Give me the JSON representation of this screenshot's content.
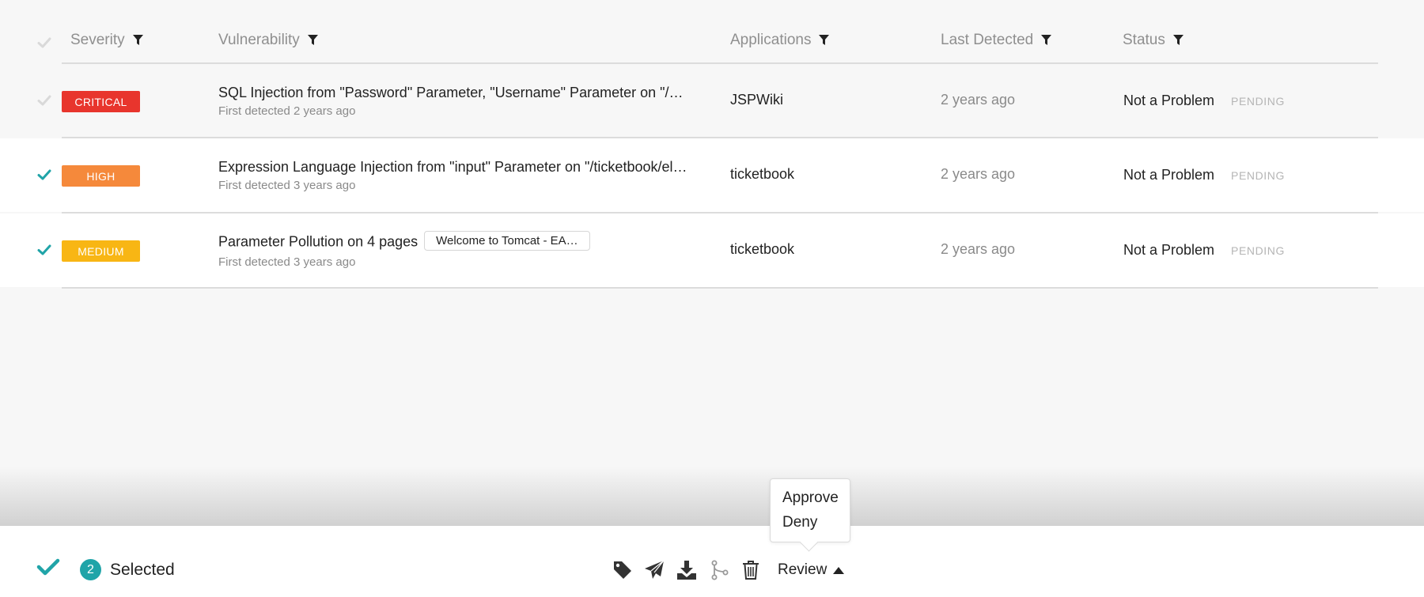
{
  "header": {
    "severity": "Severity",
    "vulnerability": "Vulnerability",
    "applications": "Applications",
    "last_detected": "Last Detected",
    "status": "Status"
  },
  "rows": [
    {
      "checked": false,
      "severity": "CRITICAL",
      "severity_color": "#e8352d",
      "title": "SQL Injection from \"Password\" Parameter, \"Username\" Parameter on \"/…",
      "subtitle": "First detected 2 years ago",
      "tag": "",
      "application": "JSPWiki",
      "last_detected": "2 years ago",
      "status": "Not a Problem",
      "pending": "PENDING"
    },
    {
      "checked": true,
      "severity": "HIGH",
      "severity_color": "#f5893b",
      "title": "Expression Language Injection from \"input\" Parameter on \"/ticketbook/el…",
      "subtitle": "First detected 3 years ago",
      "tag": "",
      "application": "ticketbook",
      "last_detected": "2 years ago",
      "status": "Not a Problem",
      "pending": "PENDING"
    },
    {
      "checked": true,
      "severity": "MEDIUM",
      "severity_color": "#f8b614",
      "title": "Parameter Pollution on 4 pages",
      "subtitle": "First detected 3 years ago",
      "tag": "Welcome to Tomcat - EA…",
      "application": "ticketbook",
      "last_detected": "2 years ago",
      "status": "Not a Problem",
      "pending": "PENDING"
    }
  ],
  "footer": {
    "selected_count": "2",
    "selected_label": "Selected",
    "review_label": "Review",
    "icons": [
      "tag-icon",
      "send-icon",
      "download-icon",
      "merge-icon",
      "trash-icon"
    ],
    "accent": "#20a4a8"
  },
  "review_menu": {
    "approve": "Approve",
    "deny": "Deny"
  }
}
